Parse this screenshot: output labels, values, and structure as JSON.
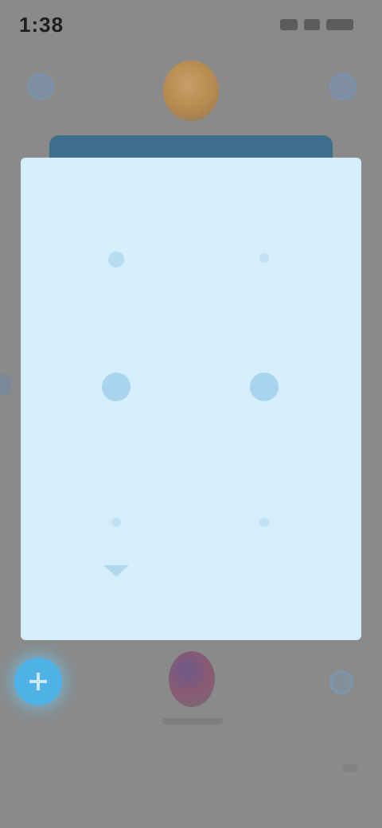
{
  "status_bar": {
    "time": "1:38",
    "icons": [
      "signal-icon",
      "wifi-icon",
      "battery-icon"
    ]
  },
  "topbar": {
    "left_icon": "menu-icon",
    "right_icon": "settings-icon",
    "avatar": "profile-avatar"
  },
  "modal": {
    "title": "",
    "options": [
      {
        "icon": "option-icon",
        "label": ""
      },
      {
        "icon": "option-icon",
        "label": ""
      },
      {
        "icon": "option-icon",
        "label": ""
      },
      {
        "icon": "option-icon",
        "label": ""
      },
      {
        "icon": "option-icon",
        "label": ""
      },
      {
        "icon": "option-icon",
        "label": ""
      }
    ]
  },
  "bottom_bar": {
    "fab_icon": "plus-icon",
    "center_icon": "flag-avatar",
    "right_icon": "gear-icon"
  },
  "colors": {
    "overlay": "#8a8a8a",
    "modal_background": "#d6eefb",
    "accent": "#4fb3e8",
    "tab_strip": "#3d6e8c",
    "option_text": "#88c2e6"
  }
}
